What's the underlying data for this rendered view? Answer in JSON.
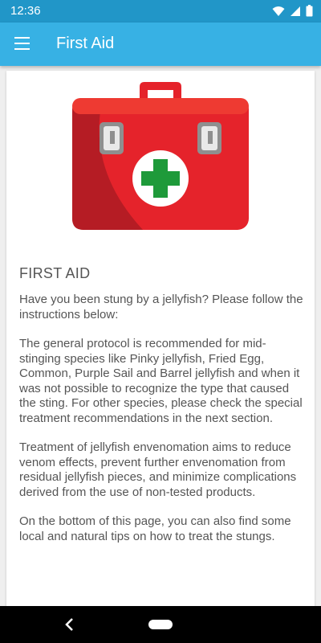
{
  "status_bar": {
    "time": "12:36",
    "icons": [
      "wifi-icon",
      "signal-icon",
      "battery-icon"
    ]
  },
  "app_bar": {
    "title": "First Aid",
    "menu_icon": "hamburger-menu-icon"
  },
  "content": {
    "image": "first-aid-kit",
    "heading": "FIRST AID",
    "paragraphs": [
      "Have you been stung by a jellyfish? Please follow the instructions below:",
      "The general protocol is recommended for mid-stinging species like Pinky jellyfish, Fried Egg, Common, Purple Sail and Barrel jellyfish and when it was not possible to recognize the type that caused the sting. For other species, please check the special treatment recommendations in the next section.",
      "Treatment of jellyfish envenomation aims to reduce venom effects, prevent further envenomation from residual jellyfish pieces, and minimize complications derived from the use of non-tested products.",
      "On the bottom of this page, you can also find some local and natural tips on how to treat the stungs."
    ]
  },
  "nav_bar": {
    "back_icon": "back-icon",
    "home_icon": "home-pill-icon"
  },
  "colors": {
    "status_bar": "#2196c8",
    "app_bar": "#37b1e4",
    "kit_red": "#e5232b",
    "cross_green": "#1e9a3a"
  }
}
